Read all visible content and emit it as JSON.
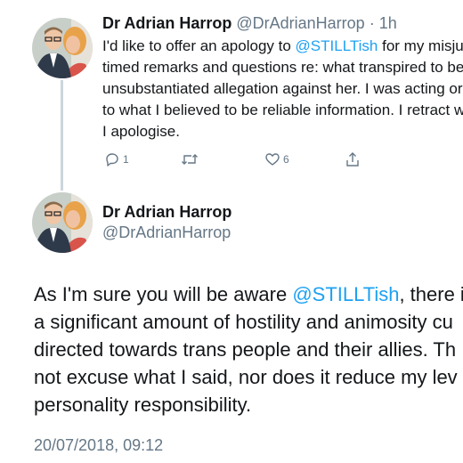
{
  "reply_tweet": {
    "display_name": "Dr Adrian Harrop",
    "handle": "@DrAdrianHarrop",
    "separator": " · ",
    "time_ago": "1h",
    "body_lines": [
      [
        {
          "text": "I'd like to offer an apology to "
        },
        {
          "text": "@STILLTish",
          "link": true
        },
        {
          "text": " for my misju"
        }
      ],
      [
        {
          "text": "timed remarks and questions re: what transpired to be"
        }
      ],
      [
        {
          "text": "unsubstantiated allegation against her. I was acting or"
        }
      ],
      [
        {
          "text": "to what I believed to be reliable information. I retract w"
        }
      ],
      [
        {
          "text": "I apologise."
        }
      ]
    ],
    "actions": {
      "reply_count": "1",
      "retweet_count": "",
      "like_count": "6"
    }
  },
  "main_tweet": {
    "display_name": "Dr Adrian Harrop",
    "handle": "@DrAdrianHarrop",
    "body_lines": [
      [
        {
          "text": "As I'm sure you will be aware "
        },
        {
          "text": "@STILLTish",
          "link": true
        },
        {
          "text": ", there i"
        }
      ],
      [
        {
          "text": "a significant amount of hostility and animosity cu"
        }
      ],
      [
        {
          "text": "directed towards trans people and their allies. Th"
        }
      ],
      [
        {
          "text": "not excuse what I said, nor does it reduce my lev"
        }
      ],
      [
        {
          "text": "personality responsibility."
        }
      ]
    ],
    "timestamp": "20/07/2018, 09:12"
  },
  "colors": {
    "link": "#1da1f2",
    "muted": "#657786",
    "thread_line": "#ccd6dd"
  }
}
